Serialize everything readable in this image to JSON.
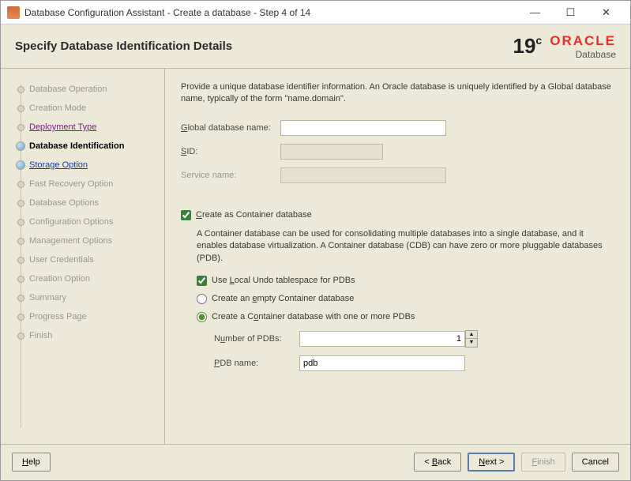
{
  "window": {
    "title": "Database Configuration Assistant - Create a database - Step 4 of 14"
  },
  "header": {
    "title": "Specify Database Identification Details",
    "version": "19",
    "version_suffix": "c",
    "brand_top": "ORACLE",
    "brand_bottom": "Database"
  },
  "sidebar": {
    "items": [
      {
        "label": "Database Operation",
        "state": "disabled"
      },
      {
        "label": "Creation Mode",
        "state": "disabled"
      },
      {
        "label": "Deployment Type",
        "state": "visited"
      },
      {
        "label": "Database Identification",
        "state": "current"
      },
      {
        "label": "Storage Option",
        "state": "link"
      },
      {
        "label": "Fast Recovery Option",
        "state": "disabled"
      },
      {
        "label": "Database Options",
        "state": "disabled"
      },
      {
        "label": "Configuration Options",
        "state": "disabled"
      },
      {
        "label": "Management Options",
        "state": "disabled"
      },
      {
        "label": "User Credentials",
        "state": "disabled"
      },
      {
        "label": "Creation Option",
        "state": "disabled"
      },
      {
        "label": "Summary",
        "state": "disabled"
      },
      {
        "label": "Progress Page",
        "state": "disabled"
      },
      {
        "label": "Finish",
        "state": "disabled"
      }
    ]
  },
  "content": {
    "intro": "Provide a unique database identifier information. An Oracle database is uniquely identified by a Global database name, typically of the form \"name.domain\".",
    "global_db_label": "Global database name:",
    "global_db_value": "",
    "sid_label": "SID:",
    "sid_value": "",
    "service_label": "Service name:",
    "service_value": "",
    "create_container_label": "Create as Container database",
    "create_container_checked": true,
    "container_desc": "A Container database can be used for consolidating multiple databases into a single database, and it enables database virtualization. A Container database (CDB) can have zero or more pluggable databases (PDB).",
    "local_undo_label": "Use Local Undo tablespace for PDBs",
    "local_undo_checked": true,
    "radio_empty_label": "Create an empty Container database",
    "radio_pdb_label": "Create a Container database with one or more PDBs",
    "radio_selected": "pdb",
    "num_pdbs_label": "Number of PDBs:",
    "num_pdbs_value": "1",
    "pdb_name_label": "PDB name:",
    "pdb_name_value": "pdb"
  },
  "footer": {
    "help": "Help",
    "back": "< Back",
    "next": "Next >",
    "finish": "Finish",
    "cancel": "Cancel"
  }
}
